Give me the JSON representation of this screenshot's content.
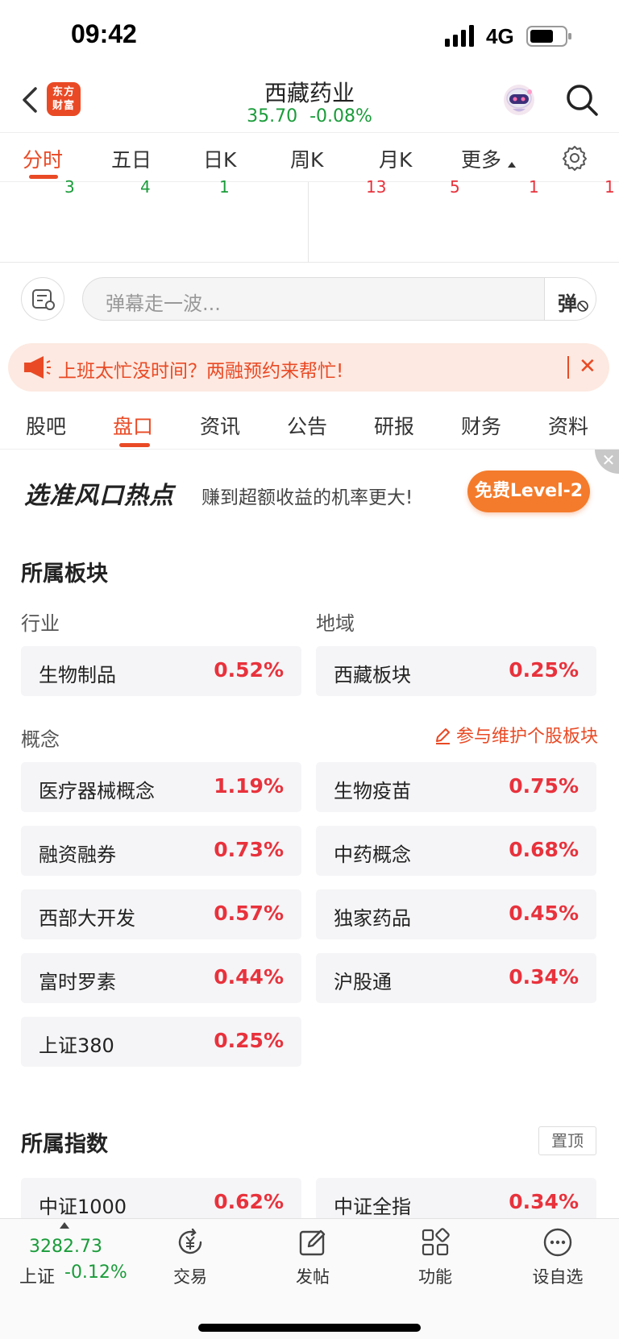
{
  "status_bar": {
    "time": "09:42",
    "network": "4G"
  },
  "header": {
    "logo_line1": "东方",
    "logo_line2": "财富",
    "stock_name": "西藏药业",
    "price": "35.70",
    "change": "-0.08%",
    "quote_color": "#1a9c3a"
  },
  "chart_tabs": [
    "分时",
    "五日",
    "日K",
    "周K",
    "月K",
    "更多"
  ],
  "trade_counts": {
    "left": [
      "3",
      "4",
      "1"
    ],
    "right": [
      "13",
      "5",
      "1",
      "1"
    ]
  },
  "danmu": {
    "placeholder": "弹幕走一波...",
    "toggle_label": "弹"
  },
  "promo": {
    "text": "上班太忙没时间？两融预约来帮忙!",
    "close": "✕"
  },
  "content_tabs": [
    "股吧",
    "盘口",
    "资讯",
    "公告",
    "研报",
    "财务",
    "资料"
  ],
  "ad": {
    "slogan": "选准风口热点",
    "subtext": "赚到超额收益的机率更大!",
    "cta": "免费Level-2",
    "close": "✕"
  },
  "sectors": {
    "title": "所属板块",
    "industry_label": "行业",
    "region_label": "地域",
    "concept_label": "概念",
    "maintain_link": "参与维护个股板块",
    "industry": {
      "name": "生物制品",
      "change": "0.52%"
    },
    "region": {
      "name": "西藏板块",
      "change": "0.25%"
    },
    "concepts": [
      {
        "name": "医疗器械概念",
        "change": "1.19%"
      },
      {
        "name": "生物疫苗",
        "change": "0.75%"
      },
      {
        "name": "融资融券",
        "change": "0.73%"
      },
      {
        "name": "中药概念",
        "change": "0.68%"
      },
      {
        "name": "西部大开发",
        "change": "0.57%"
      },
      {
        "name": "独家药品",
        "change": "0.45%"
      },
      {
        "name": "富时罗素",
        "change": "0.44%"
      },
      {
        "name": "沪股通",
        "change": "0.34%"
      },
      {
        "name": "上证380",
        "change": "0.25%"
      }
    ]
  },
  "indices": {
    "title": "所属指数",
    "pin_label": "置顶",
    "items": [
      {
        "name": "中证1000",
        "change": "0.62%"
      },
      {
        "name": "中证全指",
        "change": "0.34%"
      }
    ]
  },
  "bottom_nav": {
    "index_value": "3282.73",
    "index_label": "上证",
    "index_change": "-0.12%",
    "items": [
      "交易",
      "发帖",
      "功能",
      "设自选"
    ]
  },
  "colors": {
    "accent": "#e94a25",
    "up": "#e8323c",
    "down": "#1a9c3a"
  }
}
